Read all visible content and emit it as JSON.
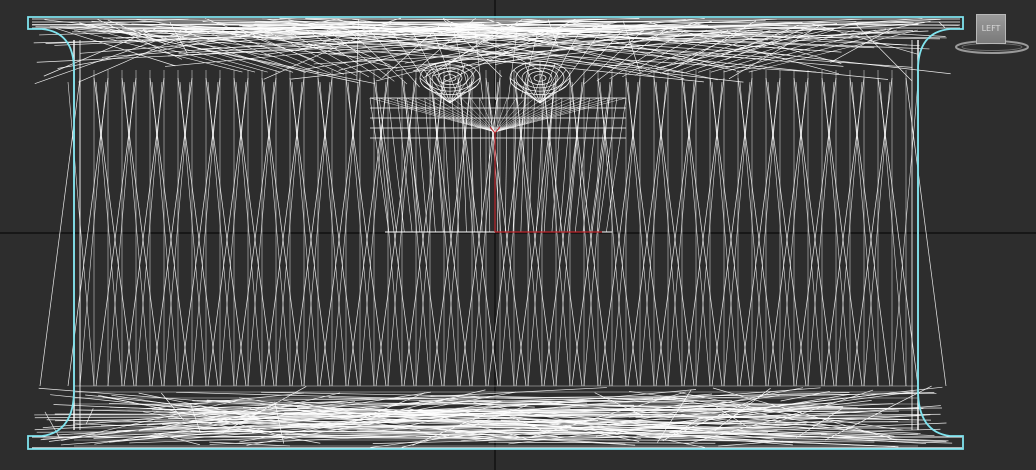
{
  "viewport": {
    "background": "#2d2d2d",
    "axis_color": "#0b0b0b",
    "mesh_color": "#ffffff",
    "selection_outline_color": "#7fe3ee",
    "pivot_color": "#c0272d"
  },
  "viewcube": {
    "face_label": "LEFT",
    "icon": "viewcube-icon"
  }
}
